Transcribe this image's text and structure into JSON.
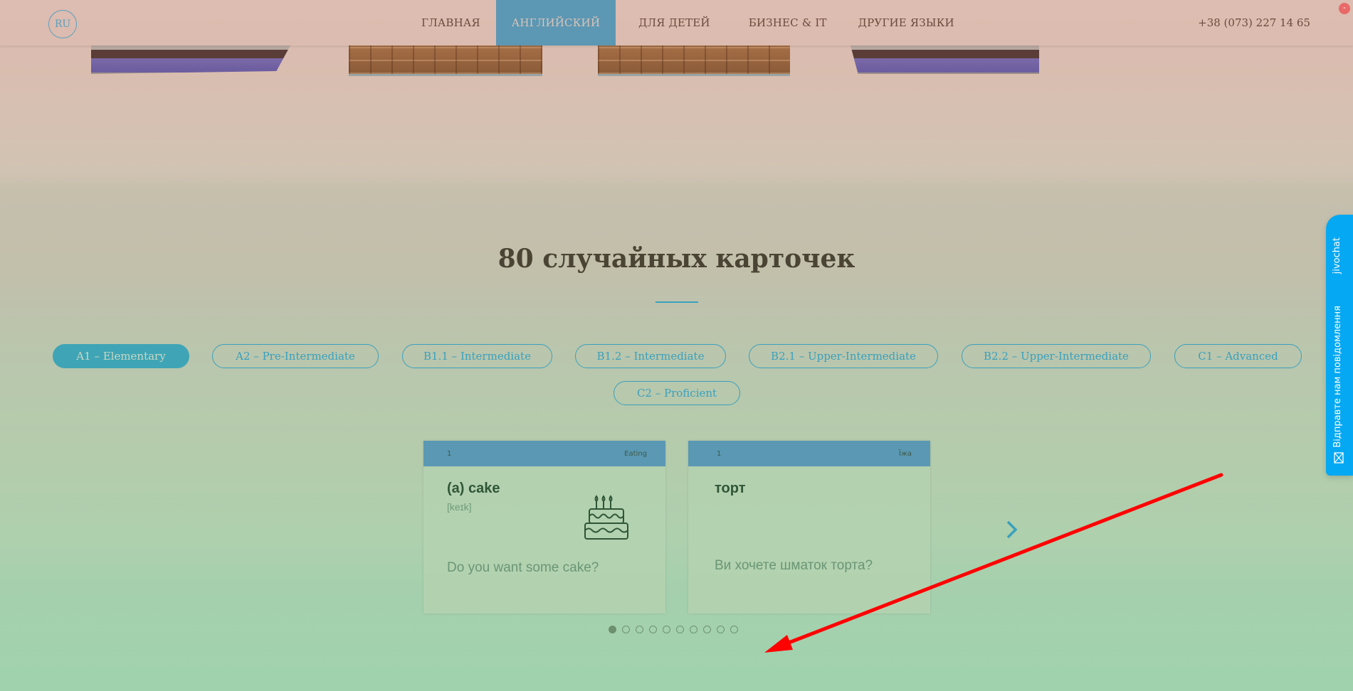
{
  "header": {
    "lang": "RU",
    "nav": [
      {
        "label": "ГЛАВНАЯ",
        "active": false
      },
      {
        "label": "АНГЛИЙСКИЙ",
        "active": true
      },
      {
        "label": "ДЛЯ ДЕТЕЙ",
        "active": false
      },
      {
        "label": "БИЗНЕС & IT",
        "active": false
      },
      {
        "label": "ДРУГИЕ ЯЗЫКИ",
        "active": false
      }
    ],
    "phone": "+38 (073) 227 14 65",
    "close_label": "-"
  },
  "section": {
    "title": "80 случайных карточек",
    "accent_color": "#3aa0bd"
  },
  "levels": [
    {
      "label": "A1 – Elementary",
      "active": true
    },
    {
      "label": "A2 – Pre-Intermediate",
      "active": false
    },
    {
      "label": "B1.1 – Intermediate",
      "active": false
    },
    {
      "label": "B1.2 – Intermediate",
      "active": false
    },
    {
      "label": "B2.1 – Upper-Intermediate",
      "active": false
    },
    {
      "label": "B2.2 – Upper-Intermediate",
      "active": false
    },
    {
      "label": "C1 – Advanced",
      "active": false
    },
    {
      "label": "C2 – Proficient",
      "active": false
    }
  ],
  "cards": [
    {
      "number": "1",
      "category": "Eating",
      "word": "(a) cake",
      "phonetic": "[keɪk]",
      "example": "Do you want some cake?",
      "icon": "birthday-cake-icon"
    },
    {
      "number": "1",
      "category": "Їжа",
      "word": "торт",
      "phonetic": "",
      "example": "Ви хочете шматок торта?",
      "icon": ""
    }
  ],
  "pagination": {
    "total": 10,
    "current": 1
  },
  "jivochat": {
    "brand": "jivochat",
    "message": "Відправте нам повідомлення",
    "color": "#05a8f3"
  }
}
